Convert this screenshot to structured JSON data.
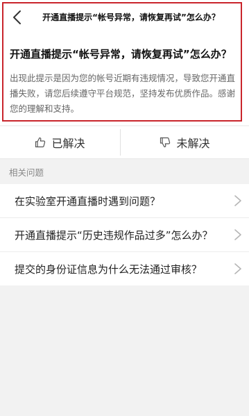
{
  "header": {
    "title": "开通直播提示“帐号异常，请恢复再试”怎么办？",
    "back_icon": "chevron-left-icon"
  },
  "article": {
    "headline": "开通直播提示“帐号异常，请恢复再试”怎么办？",
    "body": "出现此提示是因为您的帐号近期有违规情况，导致您开通直播失败，请您后续遵守平台规范，坚持发布优质作品。感谢您的理解和支持。"
  },
  "feedback": {
    "resolved_label": "已解决",
    "resolved_icon": "thumbs-up-icon",
    "unresolved_label": "未解决",
    "unresolved_icon": "thumbs-down-icon"
  },
  "related": {
    "section_title": "相关问题",
    "items": [
      {
        "label": "在实验室开通直播时遇到问题？"
      },
      {
        "label": "开通直播提示“历史违规作品过多”怎么办？"
      },
      {
        "label": "提交的身份证信息为什么无法通过审核？"
      }
    ]
  },
  "colors": {
    "highlight_border": "#c9242b",
    "background": "#f2f2f2",
    "card": "#ffffff"
  }
}
